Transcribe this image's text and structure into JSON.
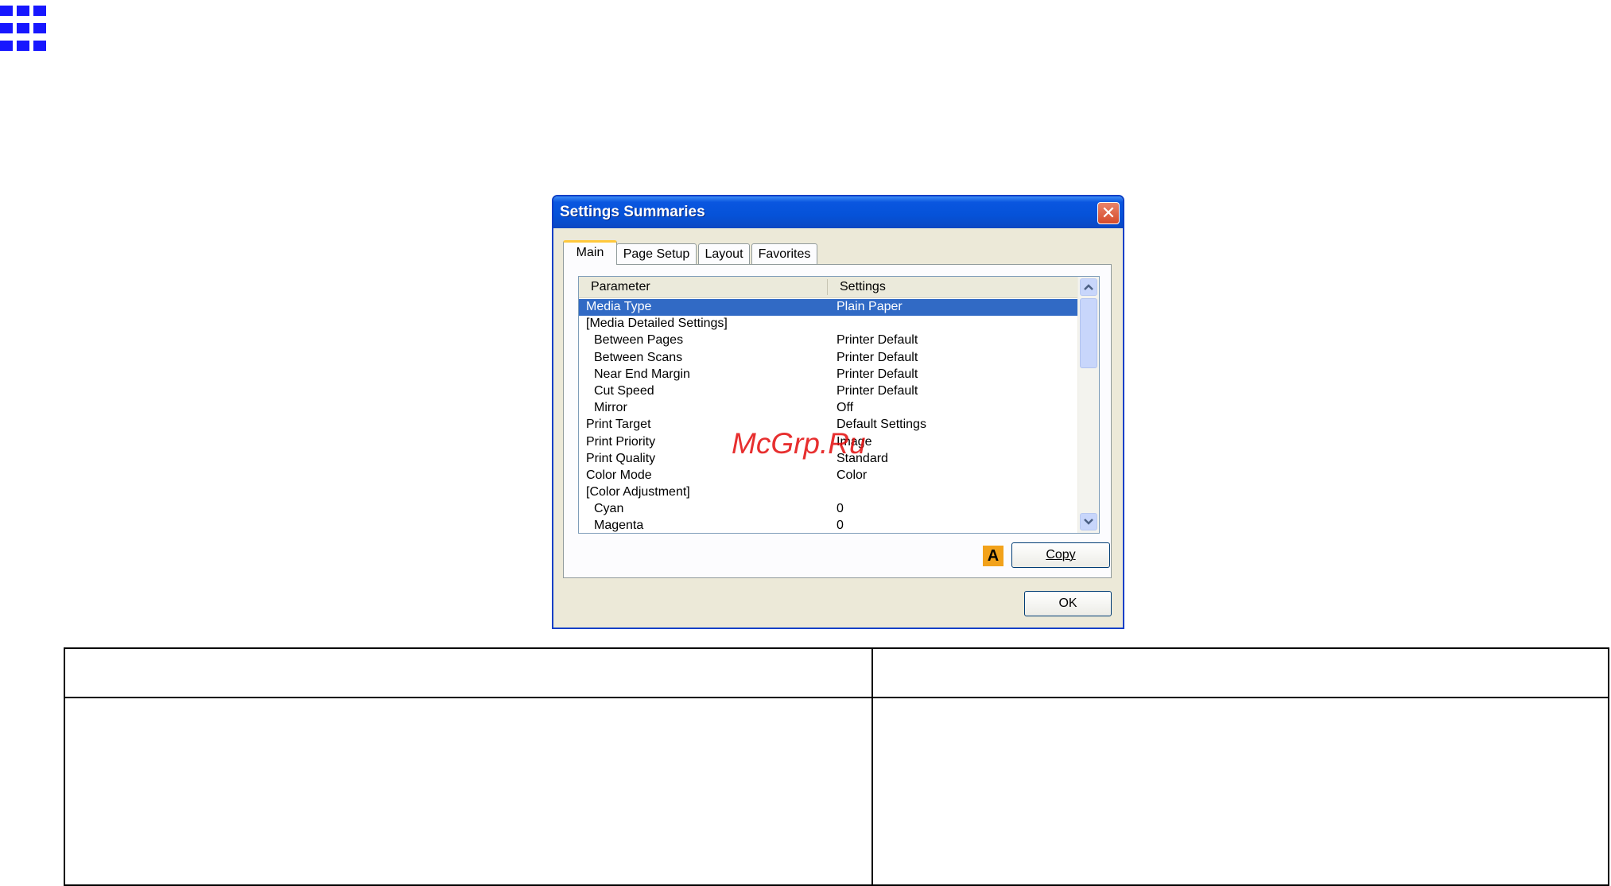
{
  "dialog": {
    "title": "Settings Summaries",
    "close_glyph": "✕",
    "tabs": [
      {
        "label": "Main"
      },
      {
        "label": "Page Setup"
      },
      {
        "label": "Layout"
      },
      {
        "label": "Favorites"
      }
    ],
    "list": {
      "columns": [
        "Parameter",
        "Settings"
      ],
      "rows": [
        {
          "parameter": "Media Type",
          "setting": "Plain Paper"
        },
        {
          "parameter": "[Media Detailed Settings]",
          "setting": ""
        },
        {
          "parameter": "Between Pages",
          "setting": "Printer Default"
        },
        {
          "parameter": "Between Scans",
          "setting": "Printer Default"
        },
        {
          "parameter": "Near End Margin",
          "setting": "Printer Default"
        },
        {
          "parameter": "Cut Speed",
          "setting": "Printer Default"
        },
        {
          "parameter": "Mirror",
          "setting": "Off"
        },
        {
          "parameter": "Print Target",
          "setting": "Default Settings"
        },
        {
          "parameter": "Print Priority",
          "setting": "Image"
        },
        {
          "parameter": "Print Quality",
          "setting": "Standard"
        },
        {
          "parameter": "Color Mode",
          "setting": "Color"
        },
        {
          "parameter": "[Color Adjustment]",
          "setting": ""
        },
        {
          "parameter": "Cyan",
          "setting": "0"
        },
        {
          "parameter": "Magenta",
          "setting": "0"
        }
      ]
    },
    "marker_label": "A",
    "copy_label": "Copy",
    "ok_label": "OK"
  },
  "watermark": "McGrp.Ru",
  "icons": {
    "grid": "grid-icon",
    "scroll_up": "chevron-up-icon",
    "scroll_down": "chevron-down-icon",
    "close": "close-icon"
  },
  "colors": {
    "titlebar": "#0552d8",
    "selection": "#316ac5",
    "marker": "#f2a21b",
    "grid_icon": "#1717ff",
    "watermark": "#e30b0b"
  }
}
